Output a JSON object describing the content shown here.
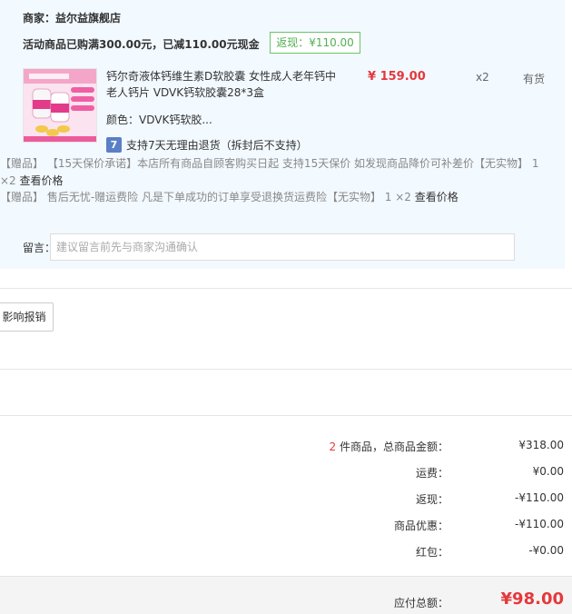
{
  "shop": {
    "merchant": "商家：益尔益旗舰店",
    "promo": "活动商品已购满300.00元，已减110.00元现金",
    "rebate_badge": "返现：¥110.00"
  },
  "item": {
    "title": "钙尔奇液体钙维生素D软胶囊 女性成人老年钙中老人钙片 VDVK钙软胶囊28*3盒",
    "price": "¥ 159.00",
    "qty": "x2",
    "stock": "有货",
    "color": "颜色：VDVK钙软胶...",
    "return_icon": "7",
    "return_policy": "支持7天无理由退货（拆封后不支持）"
  },
  "gifts": [
    {
      "tag": "【赠品】",
      "text": "【15天保价承诺】本店所有商品自顾客购买日起 支持15天保价 如发现商品降价可补差价【无实物】 1 ×2",
      "link": "查看价格"
    },
    {
      "tag": "【赠品】",
      "text": "售后无忧-赠运费险 凡是下单成功的订单享受退换货运费险【无实物】 1 ×2",
      "link": "查看价格"
    }
  ],
  "message": {
    "label": "留言：",
    "placeholder": "建议留言前先与商家沟通确认"
  },
  "impact_button": "影响报销",
  "summary": {
    "count": "2",
    "items_label": " 件商品，总商品金额：",
    "items_amount": "¥318.00",
    "shipping_label": "运费：",
    "shipping_amount": "¥0.00",
    "rebate_label": "返现：",
    "rebate_amount": "-¥110.00",
    "discount_label": "商品优惠：",
    "discount_amount": "-¥110.00",
    "redpack_label": "红包：",
    "redpack_amount": "-¥0.00",
    "total_label": "应付总额：",
    "total_amount": "¥98.00"
  },
  "colors": {
    "accent_red": "#e4393c",
    "rebate_green": "#52b152",
    "shop_bg": "#f2f9ff"
  }
}
